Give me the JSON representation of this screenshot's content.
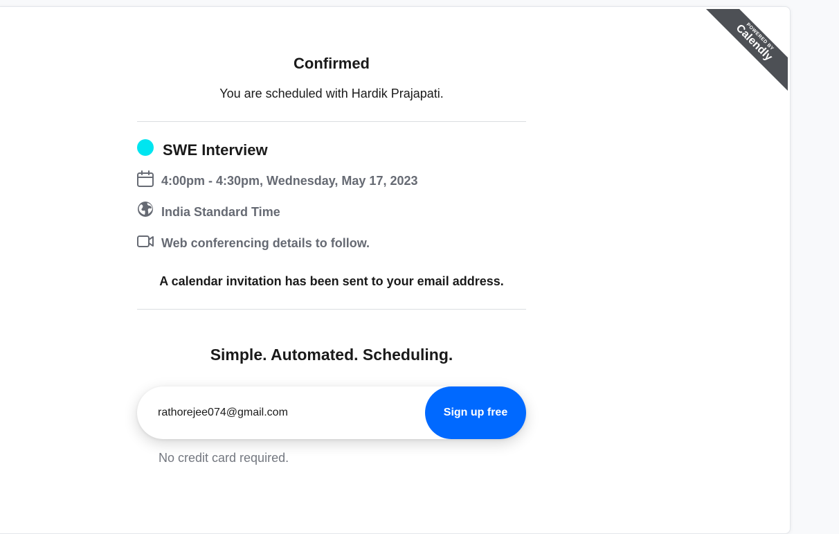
{
  "badge": {
    "line1": "POWERED BY",
    "line2": "Calendly"
  },
  "confirmation": {
    "title": "Confirmed",
    "subtitle": "You are scheduled with Hardik Prajapati."
  },
  "event": {
    "name": "SWE Interview",
    "dot_color": "#00e5f0",
    "details": [
      {
        "icon": "calendar-icon",
        "text": "4:00pm - 4:30pm, Wednesday, May 17, 2023"
      },
      {
        "icon": "globe-icon",
        "text": "India Standard Time"
      },
      {
        "icon": "video-camera-icon",
        "text": "Web conferencing details to follow."
      }
    ],
    "invite_note": "A calendar invitation has been sent to your email address."
  },
  "promo": {
    "title": "Simple. Automated. Scheduling.",
    "email_value": "rathorejee074@gmail.com",
    "button_label": "Sign up free",
    "button_color": "#0069ff",
    "footnote": "No credit card required."
  }
}
